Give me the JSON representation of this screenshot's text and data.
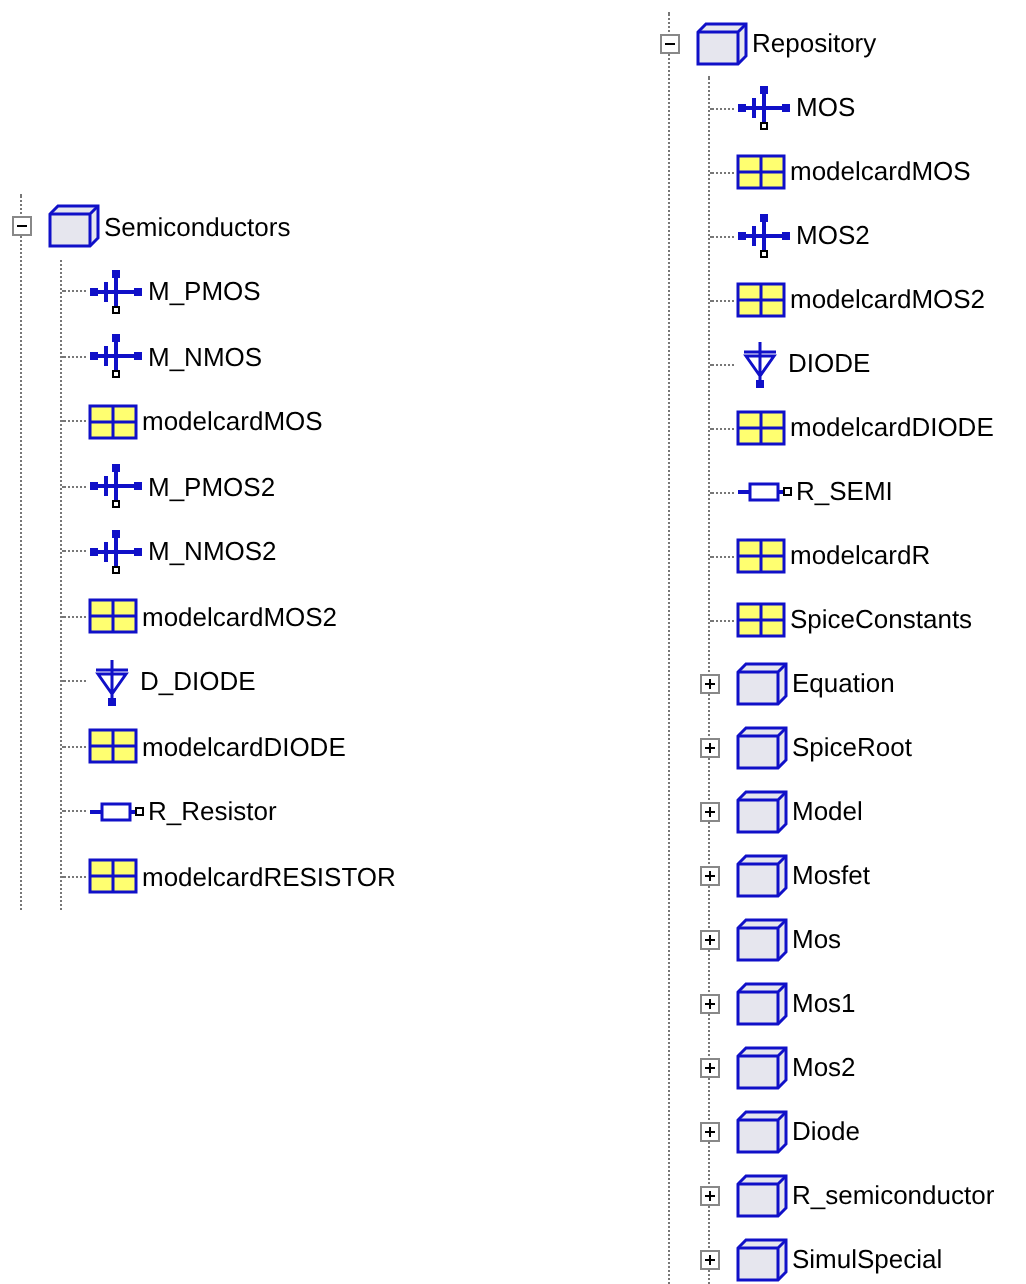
{
  "trees": [
    {
      "items": [
        {
          "label": "Semiconductors",
          "kind": "package",
          "expanded": true,
          "children": [
            {
              "label": "M_PMOS",
              "kind": "transistor"
            },
            {
              "label": "M_NMOS",
              "kind": "transistor"
            },
            {
              "label": "modelcardMOS",
              "kind": "modelcard"
            },
            {
              "label": "M_PMOS2",
              "kind": "transistor"
            },
            {
              "label": "M_NMOS2",
              "kind": "transistor"
            },
            {
              "label": "modelcardMOS2",
              "kind": "modelcard"
            },
            {
              "label": "D_DIODE",
              "kind": "diode"
            },
            {
              "label": "modelcardDIODE",
              "kind": "modelcard"
            },
            {
              "label": "R_Resistor",
              "kind": "resistor"
            },
            {
              "label": "modelcardRESISTOR",
              "kind": "modelcard"
            }
          ]
        }
      ]
    },
    {
      "items": [
        {
          "label": "Repository",
          "kind": "package",
          "expanded": true,
          "children": [
            {
              "label": "MOS",
              "kind": "transistor"
            },
            {
              "label": "modelcardMOS",
              "kind": "modelcard"
            },
            {
              "label": "MOS2",
              "kind": "transistor"
            },
            {
              "label": "modelcardMOS2",
              "kind": "modelcard"
            },
            {
              "label": "DIODE",
              "kind": "diode"
            },
            {
              "label": "modelcardDIODE",
              "kind": "modelcard"
            },
            {
              "label": "R_SEMI",
              "kind": "resistor"
            },
            {
              "label": "modelcardR",
              "kind": "modelcard"
            },
            {
              "label": "SpiceConstants",
              "kind": "modelcard"
            },
            {
              "label": "Equation",
              "kind": "package",
              "expanded": false
            },
            {
              "label": "SpiceRoot",
              "kind": "package",
              "expanded": false
            },
            {
              "label": "Model",
              "kind": "package",
              "expanded": false
            },
            {
              "label": "Mosfet",
              "kind": "package",
              "expanded": false
            },
            {
              "label": "Mos",
              "kind": "package",
              "expanded": false
            },
            {
              "label": "Mos1",
              "kind": "package",
              "expanded": false
            },
            {
              "label": "Mos2",
              "kind": "package",
              "expanded": false
            },
            {
              "label": "Diode",
              "kind": "package",
              "expanded": false
            },
            {
              "label": "R_semiconductor",
              "kind": "package",
              "expanded": false
            },
            {
              "label": "SimulSpecial",
              "kind": "package",
              "expanded": false
            }
          ]
        }
      ]
    }
  ]
}
